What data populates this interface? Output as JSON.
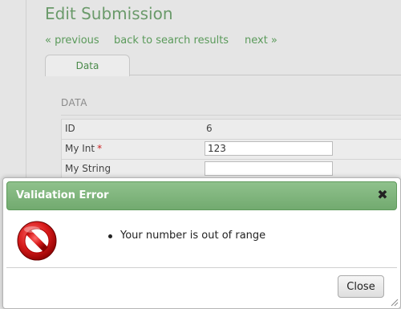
{
  "page": {
    "title": "Edit Submission",
    "nav": {
      "previous": "« previous",
      "back": "back to search results",
      "next": "next »"
    },
    "tabs": [
      {
        "label": "Data",
        "active": true
      }
    ],
    "section_title": "DATA",
    "fields": [
      {
        "label": "ID",
        "value": "6",
        "type": "text"
      },
      {
        "label": "My Int",
        "required_mark": "*",
        "value": "123",
        "type": "input"
      },
      {
        "label": "My String",
        "value": "",
        "type": "input"
      }
    ]
  },
  "dialog": {
    "title": "Validation Error",
    "close_icon": "close-x-icon",
    "icon": "prohibited-icon",
    "messages": [
      "Your number is out of range"
    ],
    "close_button_label": "Close"
  },
  "colors": {
    "accent_green": "#72aa6f",
    "link_green": "#5a9a5a",
    "error_red": "#cc2222"
  }
}
